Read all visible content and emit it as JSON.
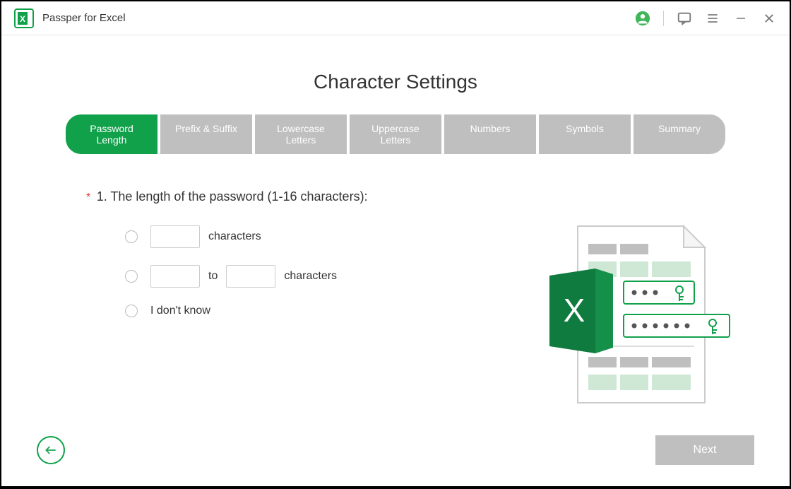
{
  "header": {
    "app_title": "Passper for Excel"
  },
  "page": {
    "title": "Character Settings"
  },
  "tabs": [
    {
      "label": "Password Length",
      "active": true
    },
    {
      "label": "Prefix & Suffix",
      "active": false
    },
    {
      "label": "Lowercase Letters",
      "active": false
    },
    {
      "label": "Uppercase Letters",
      "active": false
    },
    {
      "label": "Numbers",
      "active": false
    },
    {
      "label": "Symbols",
      "active": false
    },
    {
      "label": "Summary",
      "active": false
    }
  ],
  "question": {
    "prefix": "*",
    "text": "1. The length of the password (1-16 characters):"
  },
  "options": {
    "exact": {
      "chars_input": "",
      "label": "characters"
    },
    "range": {
      "from_input": "",
      "to_label": "to",
      "to_input": "",
      "label": "characters"
    },
    "dontknow": {
      "label": "I don't know"
    }
  },
  "footer": {
    "next_label": "Next"
  }
}
